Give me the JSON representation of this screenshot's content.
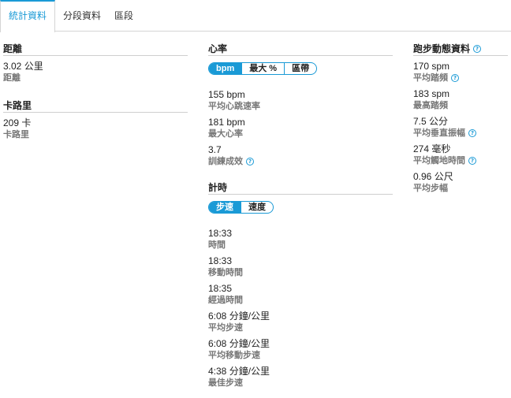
{
  "tabs": [
    {
      "label": "統計資料",
      "active": true
    },
    {
      "label": "分段資料",
      "active": false
    },
    {
      "label": "區段",
      "active": false
    }
  ],
  "distance": {
    "title": "距離",
    "value": "3.02 公里",
    "label": "距離"
  },
  "calories": {
    "title": "卡路里",
    "value": "209 卡",
    "label": "卡路里"
  },
  "heart_rate": {
    "title": "心率",
    "toggle": [
      "bpm",
      "最大 %",
      "區帶"
    ],
    "stats": [
      {
        "value": "155 bpm",
        "label": "平均心跳速率"
      },
      {
        "value": "181 bpm",
        "label": "最大心率"
      },
      {
        "value": "3.7",
        "label": "訓練成效",
        "help": true
      }
    ]
  },
  "timing": {
    "title": "計時",
    "toggle": [
      "步速",
      "速度"
    ],
    "stats": [
      {
        "value": "18:33",
        "label": "時間"
      },
      {
        "value": "18:33",
        "label": "移動時間"
      },
      {
        "value": "18:35",
        "label": "經過時間"
      },
      {
        "value": "6:08 分鐘/公里",
        "label": "平均步速"
      },
      {
        "value": "6:08 分鐘/公里",
        "label": "平均移動步速"
      },
      {
        "value": "4:38 分鐘/公里",
        "label": "最佳步速"
      }
    ]
  },
  "running_dynamics": {
    "title": "跑步動態資料",
    "stats": [
      {
        "value": "170 spm",
        "label": "平均踏頻",
        "help": true
      },
      {
        "value": "183 spm",
        "label": "最高踏頻"
      },
      {
        "value": "7.5 公分",
        "label": "平均垂直振幅",
        "help": true
      },
      {
        "value": "274 毫秒",
        "label": "平均觸地時間",
        "help": true
      },
      {
        "value": "0.96 公尺",
        "label": "平均步幅"
      }
    ]
  },
  "help_glyph": "?",
  "colors": {
    "accent": "#1a9ad6",
    "label": "#777777",
    "divider": "#cfcfcf"
  }
}
